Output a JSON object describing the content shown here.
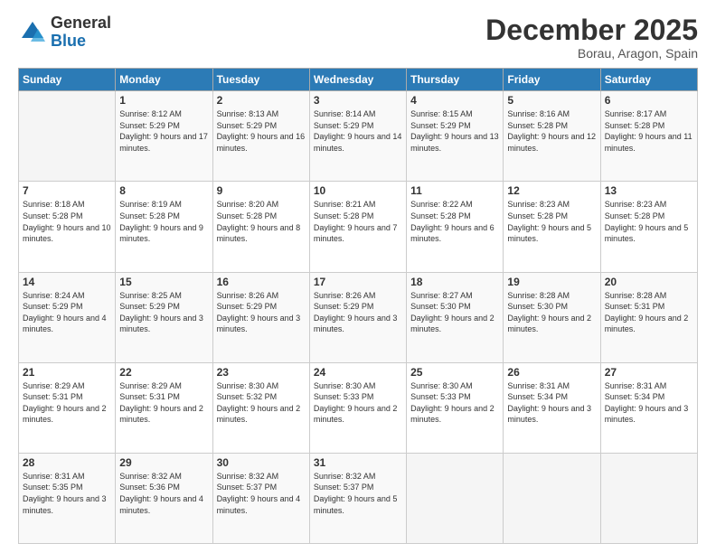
{
  "logo": {
    "general": "General",
    "blue": "Blue"
  },
  "title": "December 2025",
  "location": "Borau, Aragon, Spain",
  "days_of_week": [
    "Sunday",
    "Monday",
    "Tuesday",
    "Wednesday",
    "Thursday",
    "Friday",
    "Saturday"
  ],
  "weeks": [
    [
      {
        "day": "",
        "sunrise": "",
        "sunset": "",
        "daylight": ""
      },
      {
        "day": "1",
        "sunrise": "Sunrise: 8:12 AM",
        "sunset": "Sunset: 5:29 PM",
        "daylight": "Daylight: 9 hours and 17 minutes."
      },
      {
        "day": "2",
        "sunrise": "Sunrise: 8:13 AM",
        "sunset": "Sunset: 5:29 PM",
        "daylight": "Daylight: 9 hours and 16 minutes."
      },
      {
        "day": "3",
        "sunrise": "Sunrise: 8:14 AM",
        "sunset": "Sunset: 5:29 PM",
        "daylight": "Daylight: 9 hours and 14 minutes."
      },
      {
        "day": "4",
        "sunrise": "Sunrise: 8:15 AM",
        "sunset": "Sunset: 5:29 PM",
        "daylight": "Daylight: 9 hours and 13 minutes."
      },
      {
        "day": "5",
        "sunrise": "Sunrise: 8:16 AM",
        "sunset": "Sunset: 5:28 PM",
        "daylight": "Daylight: 9 hours and 12 minutes."
      },
      {
        "day": "6",
        "sunrise": "Sunrise: 8:17 AM",
        "sunset": "Sunset: 5:28 PM",
        "daylight": "Daylight: 9 hours and 11 minutes."
      }
    ],
    [
      {
        "day": "7",
        "sunrise": "Sunrise: 8:18 AM",
        "sunset": "Sunset: 5:28 PM",
        "daylight": "Daylight: 9 hours and 10 minutes."
      },
      {
        "day": "8",
        "sunrise": "Sunrise: 8:19 AM",
        "sunset": "Sunset: 5:28 PM",
        "daylight": "Daylight: 9 hours and 9 minutes."
      },
      {
        "day": "9",
        "sunrise": "Sunrise: 8:20 AM",
        "sunset": "Sunset: 5:28 PM",
        "daylight": "Daylight: 9 hours and 8 minutes."
      },
      {
        "day": "10",
        "sunrise": "Sunrise: 8:21 AM",
        "sunset": "Sunset: 5:28 PM",
        "daylight": "Daylight: 9 hours and 7 minutes."
      },
      {
        "day": "11",
        "sunrise": "Sunrise: 8:22 AM",
        "sunset": "Sunset: 5:28 PM",
        "daylight": "Daylight: 9 hours and 6 minutes."
      },
      {
        "day": "12",
        "sunrise": "Sunrise: 8:23 AM",
        "sunset": "Sunset: 5:28 PM",
        "daylight": "Daylight: 9 hours and 5 minutes."
      },
      {
        "day": "13",
        "sunrise": "Sunrise: 8:23 AM",
        "sunset": "Sunset: 5:28 PM",
        "daylight": "Daylight: 9 hours and 5 minutes."
      }
    ],
    [
      {
        "day": "14",
        "sunrise": "Sunrise: 8:24 AM",
        "sunset": "Sunset: 5:29 PM",
        "daylight": "Daylight: 9 hours and 4 minutes."
      },
      {
        "day": "15",
        "sunrise": "Sunrise: 8:25 AM",
        "sunset": "Sunset: 5:29 PM",
        "daylight": "Daylight: 9 hours and 3 minutes."
      },
      {
        "day": "16",
        "sunrise": "Sunrise: 8:26 AM",
        "sunset": "Sunset: 5:29 PM",
        "daylight": "Daylight: 9 hours and 3 minutes."
      },
      {
        "day": "17",
        "sunrise": "Sunrise: 8:26 AM",
        "sunset": "Sunset: 5:29 PM",
        "daylight": "Daylight: 9 hours and 3 minutes."
      },
      {
        "day": "18",
        "sunrise": "Sunrise: 8:27 AM",
        "sunset": "Sunset: 5:30 PM",
        "daylight": "Daylight: 9 hours and 2 minutes."
      },
      {
        "day": "19",
        "sunrise": "Sunrise: 8:28 AM",
        "sunset": "Sunset: 5:30 PM",
        "daylight": "Daylight: 9 hours and 2 minutes."
      },
      {
        "day": "20",
        "sunrise": "Sunrise: 8:28 AM",
        "sunset": "Sunset: 5:31 PM",
        "daylight": "Daylight: 9 hours and 2 minutes."
      }
    ],
    [
      {
        "day": "21",
        "sunrise": "Sunrise: 8:29 AM",
        "sunset": "Sunset: 5:31 PM",
        "daylight": "Daylight: 9 hours and 2 minutes."
      },
      {
        "day": "22",
        "sunrise": "Sunrise: 8:29 AM",
        "sunset": "Sunset: 5:31 PM",
        "daylight": "Daylight: 9 hours and 2 minutes."
      },
      {
        "day": "23",
        "sunrise": "Sunrise: 8:30 AM",
        "sunset": "Sunset: 5:32 PM",
        "daylight": "Daylight: 9 hours and 2 minutes."
      },
      {
        "day": "24",
        "sunrise": "Sunrise: 8:30 AM",
        "sunset": "Sunset: 5:33 PM",
        "daylight": "Daylight: 9 hours and 2 minutes."
      },
      {
        "day": "25",
        "sunrise": "Sunrise: 8:30 AM",
        "sunset": "Sunset: 5:33 PM",
        "daylight": "Daylight: 9 hours and 2 minutes."
      },
      {
        "day": "26",
        "sunrise": "Sunrise: 8:31 AM",
        "sunset": "Sunset: 5:34 PM",
        "daylight": "Daylight: 9 hours and 3 minutes."
      },
      {
        "day": "27",
        "sunrise": "Sunrise: 8:31 AM",
        "sunset": "Sunset: 5:34 PM",
        "daylight": "Daylight: 9 hours and 3 minutes."
      }
    ],
    [
      {
        "day": "28",
        "sunrise": "Sunrise: 8:31 AM",
        "sunset": "Sunset: 5:35 PM",
        "daylight": "Daylight: 9 hours and 3 minutes."
      },
      {
        "day": "29",
        "sunrise": "Sunrise: 8:32 AM",
        "sunset": "Sunset: 5:36 PM",
        "daylight": "Daylight: 9 hours and 4 minutes."
      },
      {
        "day": "30",
        "sunrise": "Sunrise: 8:32 AM",
        "sunset": "Sunset: 5:37 PM",
        "daylight": "Daylight: 9 hours and 4 minutes."
      },
      {
        "day": "31",
        "sunrise": "Sunrise: 8:32 AM",
        "sunset": "Sunset: 5:37 PM",
        "daylight": "Daylight: 9 hours and 5 minutes."
      },
      {
        "day": "",
        "sunrise": "",
        "sunset": "",
        "daylight": ""
      },
      {
        "day": "",
        "sunrise": "",
        "sunset": "",
        "daylight": ""
      },
      {
        "day": "",
        "sunrise": "",
        "sunset": "",
        "daylight": ""
      }
    ]
  ]
}
